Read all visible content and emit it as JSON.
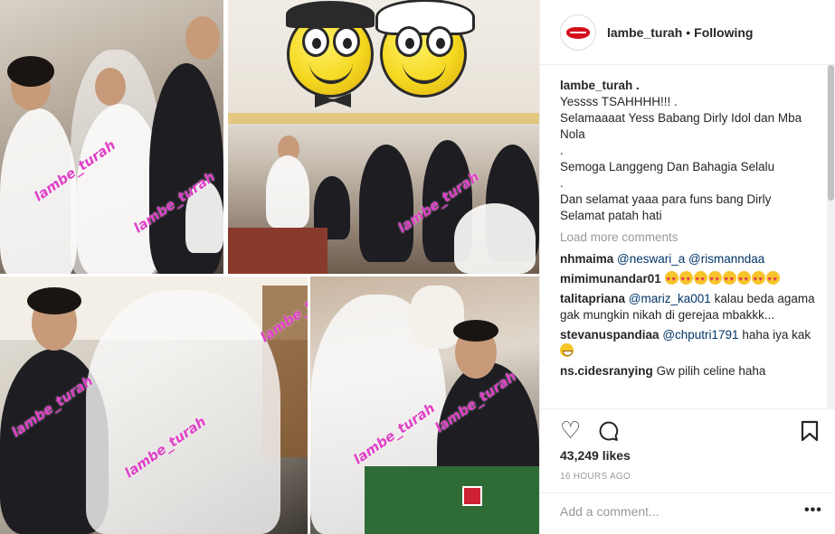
{
  "post": {
    "watermark": "lambe_turah"
  },
  "header": {
    "username": "lambe_turah",
    "separator": "•",
    "follow_status": "Following"
  },
  "caption": {
    "username": "lambe_turah .",
    "lines": [
      "Yessss TSAHHHH!!! .",
      "Selamaaaat Yess Babang Dirly Idol dan Mba Nola",
      ".",
      "Semoga Langgeng Dan Bahagia Selalu",
      ".",
      "Dan selamat yaaa para funs bang Dirly",
      "Selamat patah hati"
    ]
  },
  "load_more": "Load more comments",
  "comments": [
    {
      "user": "nhmaima",
      "text": "@neswari_a @rismanndaa",
      "emoji_count": 0
    },
    {
      "user": "mimimunandar01",
      "text": "",
      "emoji": "heart-eyes",
      "emoji_count": 8
    },
    {
      "user": "talitapriana",
      "mention": "@mariz_ka001",
      "text": "kalau beda agama gak mungkin nikah di gerejaa mbakkk..."
    },
    {
      "user": "stevanuspandiaa",
      "mention": "@chputri1791",
      "text": "haha iya kak",
      "emoji": "grin"
    },
    {
      "user": "ns.cidesranying",
      "text": "Gw pilih celine haha"
    }
  ],
  "actions": {
    "like_icon": "heart-icon",
    "comment_icon": "comment-icon",
    "save_icon": "bookmark-icon"
  },
  "likes": "43,249 likes",
  "timestamp": "16 HOURS AGO",
  "add_comment": {
    "placeholder": "Add a comment...",
    "more_label": "•••"
  },
  "colors": {
    "watermark": "#e040c8",
    "text": "#262626",
    "muted": "#999999",
    "mention": "#003569",
    "brand_lips": "#d4101e"
  }
}
